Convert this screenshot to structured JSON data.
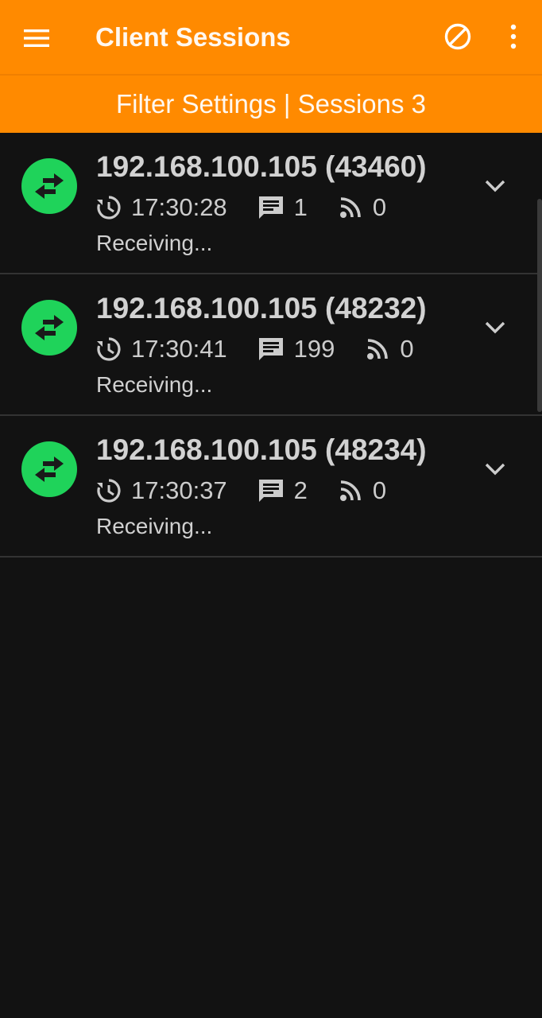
{
  "appbar": {
    "title": "Client Sessions",
    "menu_icon": "menu-icon",
    "block_icon": "block-icon",
    "more_icon": "more-vert-icon"
  },
  "filter": {
    "text": "Filter Settings | Sessions 3"
  },
  "colors": {
    "accent": "#ff8a00",
    "status_green": "#1fd35a",
    "background": "#121212"
  },
  "sessions": [
    {
      "address": "192.168.100.105 (43460)",
      "time": "17:30:28",
      "messages": "1",
      "feeds": "0",
      "status": "Receiving..."
    },
    {
      "address": "192.168.100.105 (48232)",
      "time": "17:30:41",
      "messages": "199",
      "feeds": "0",
      "status": "Receiving..."
    },
    {
      "address": "192.168.100.105 (48234)",
      "time": "17:30:37",
      "messages": "2",
      "feeds": "0",
      "status": "Receiving..."
    }
  ]
}
